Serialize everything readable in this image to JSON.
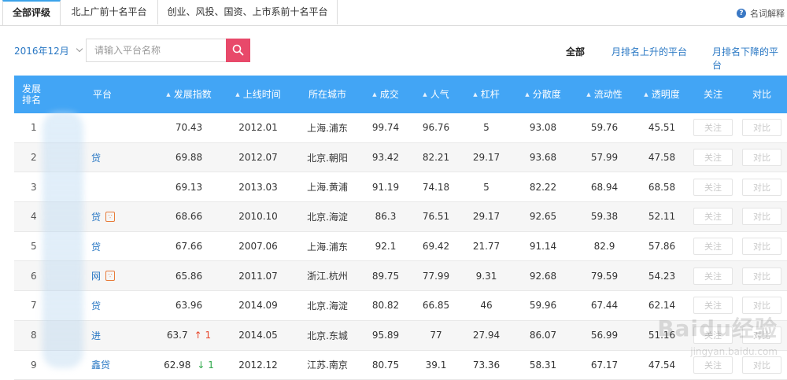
{
  "tabs": [
    {
      "label": "全部评级",
      "active": true
    },
    {
      "label": "北上广前十名平台",
      "active": false
    },
    {
      "label": "创业、风投、国资、上市系前十名平台",
      "active": false
    }
  ],
  "help": {
    "label": "名词解释"
  },
  "filters": {
    "date": "2016年12月",
    "search_placeholder": "请输入平台名称",
    "options": [
      "全部",
      "月排名上升的平台",
      "月排名下降的平台"
    ]
  },
  "table": {
    "headers": [
      "发展\n排名",
      "平台",
      "发展指数",
      "上线时间",
      "所在城市",
      "成交",
      "人气",
      "杠杆",
      "分散度",
      "流动性",
      "透明度",
      "关注",
      "对比"
    ],
    "follow_label": "关注",
    "compare_label": "对比",
    "rows": [
      {
        "rank": "1",
        "name": "",
        "badge": false,
        "index": "70.43",
        "change": "",
        "online": "2012.01",
        "city": "上海.浦东",
        "deal": "99.74",
        "pop": "96.76",
        "lev": "5",
        "disp": "93.08",
        "liq": "59.76",
        "trans": "45.51"
      },
      {
        "rank": "2",
        "name": "贷",
        "badge": false,
        "index": "69.88",
        "change": "",
        "online": "2012.07",
        "city": "北京.朝阳",
        "deal": "93.42",
        "pop": "82.21",
        "lev": "29.17",
        "disp": "93.68",
        "liq": "57.99",
        "trans": "47.58"
      },
      {
        "rank": "3",
        "name": "",
        "badge": false,
        "index": "69.13",
        "change": "",
        "online": "2013.03",
        "city": "上海.黄浦",
        "deal": "91.19",
        "pop": "74.18",
        "lev": "5",
        "disp": "82.22",
        "liq": "68.94",
        "trans": "68.58"
      },
      {
        "rank": "4",
        "name": "贷",
        "badge": true,
        "index": "68.66",
        "change": "",
        "online": "2010.10",
        "city": "北京.海淀",
        "deal": "86.3",
        "pop": "76.51",
        "lev": "29.17",
        "disp": "92.65",
        "liq": "59.38",
        "trans": "52.11"
      },
      {
        "rank": "5",
        "name": "贷",
        "badge": false,
        "index": "67.66",
        "change": "",
        "online": "2007.06",
        "city": "上海.浦东",
        "deal": "92.1",
        "pop": "69.42",
        "lev": "21.77",
        "disp": "91.14",
        "liq": "82.9",
        "trans": "57.86"
      },
      {
        "rank": "6",
        "name": "网",
        "badge": true,
        "index": "65.86",
        "change": "",
        "online": "2011.07",
        "city": "浙江.杭州",
        "deal": "89.75",
        "pop": "77.99",
        "lev": "9.31",
        "disp": "92.68",
        "liq": "79.59",
        "trans": "54.23"
      },
      {
        "rank": "7",
        "name": "贷",
        "badge": false,
        "index": "63.96",
        "change": "",
        "online": "2014.09",
        "city": "北京.海淀",
        "deal": "80.82",
        "pop": "66.85",
        "lev": "46",
        "disp": "59.96",
        "liq": "67.44",
        "trans": "62.14"
      },
      {
        "rank": "8",
        "name": "进",
        "badge": false,
        "index": "63.7",
        "change": "↑ 1",
        "change_dir": "up",
        "online": "2014.05",
        "city": "北京.东城",
        "deal": "95.89",
        "pop": "77",
        "lev": "27.94",
        "disp": "86.07",
        "liq": "56.99",
        "trans": "51.16"
      },
      {
        "rank": "9",
        "name": "鑫贷",
        "badge": false,
        "index": "62.98",
        "change": "↓ 1",
        "change_dir": "down",
        "online": "2012.12",
        "city": "江苏.南京",
        "deal": "80.75",
        "pop": "39.1",
        "lev": "73.36",
        "disp": "58.31",
        "liq": "67.17",
        "trans": "47.54"
      }
    ]
  },
  "watermark": {
    "text": "Baidu经验",
    "sub": "jingyan.baidu.com"
  },
  "colors": {
    "header": "#42a5f5",
    "accent": "#e8496a",
    "link": "#2a78c4",
    "up": "#e8492e",
    "down": "#2ea84a"
  },
  "icons": {
    "search": "search-icon",
    "help": "help-icon",
    "sort": "sort-icon"
  }
}
